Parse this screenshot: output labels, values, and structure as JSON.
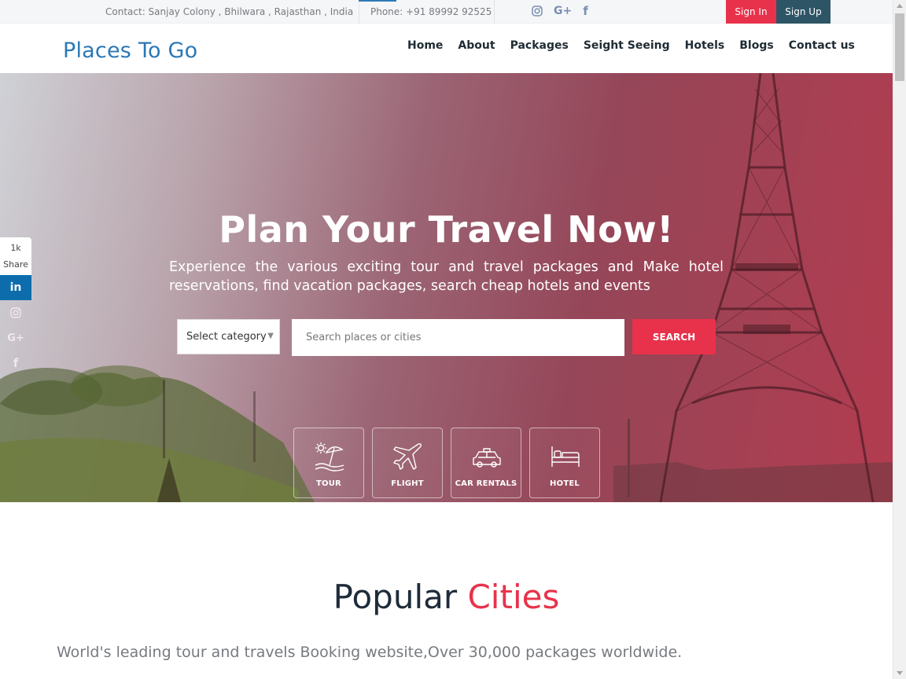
{
  "topbar": {
    "contact": "Contact: Sanjay Colony , Bhilwara , Rajasthan , India",
    "phone": "Phone: +91 89992 92525",
    "social_icons": [
      "instagram-icon",
      "google-plus-icon",
      "facebook-icon"
    ],
    "signin_label": "Sign In",
    "signup_label": "Sign Up"
  },
  "header": {
    "logo": "Places To Go",
    "nav": [
      "Home",
      "About",
      "Packages",
      "Seight Seeing",
      "Hotels",
      "Blogs",
      "Contact us"
    ]
  },
  "hero": {
    "title": "Plan Your Travel Now!",
    "subtitle": "Experience the various exciting tour and travel packages and Make hotel reservations, find vacation packages, search cheap hotels and events",
    "select_label": "Select category",
    "search_placeholder": "Search places or cities",
    "search_button": "SEARCH",
    "categories": [
      {
        "label": "TOUR",
        "icon": "beach-umbrella-icon"
      },
      {
        "label": "FLIGHT",
        "icon": "airplane-icon"
      },
      {
        "label": "CAR RENTALS",
        "icon": "taxi-icon"
      },
      {
        "label": "HOTEL",
        "icon": "bed-icon"
      }
    ]
  },
  "share_bar": {
    "count": "1k",
    "label": "Share",
    "icons": [
      "linkedin-icon",
      "instagram-icon",
      "google-plus-icon",
      "facebook-icon"
    ]
  },
  "popular": {
    "title_main": "Popular",
    "title_accent": "Cities",
    "subtitle": "World's leading tour and travels Booking website,Over 30,000 packages worldwide."
  },
  "colors": {
    "accent_red": "#e8324b",
    "logo_blue": "#2b78b7",
    "signup_teal": "#2d5566",
    "linkedin_blue": "#0d6dac"
  }
}
